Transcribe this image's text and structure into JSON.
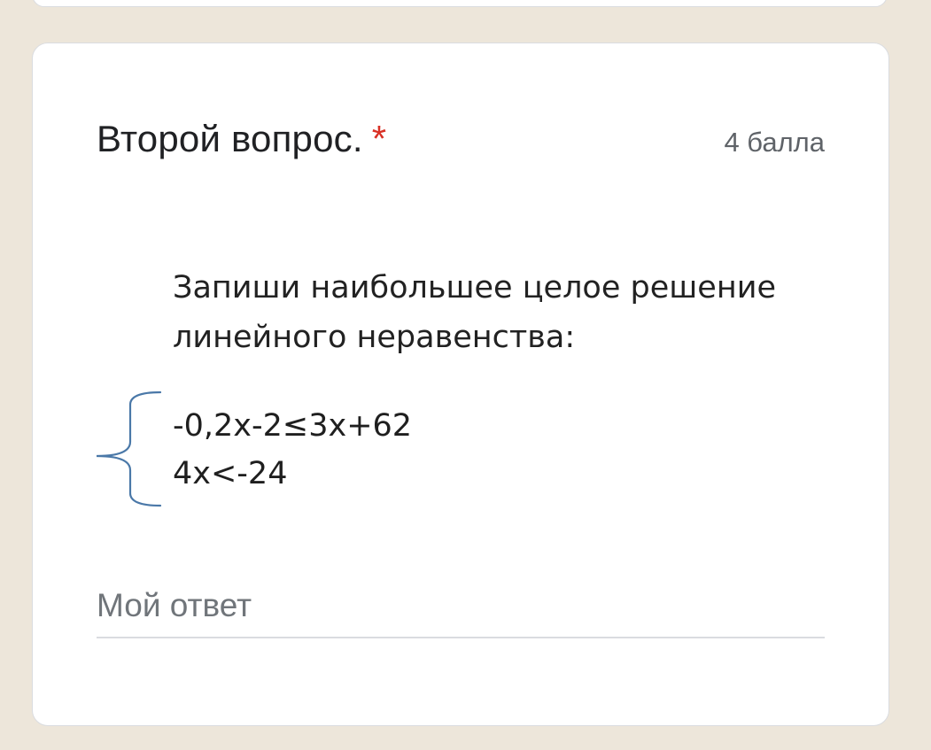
{
  "question": {
    "title": "Второй вопрос.",
    "required_mark": "*",
    "points": "4 балла"
  },
  "question_image": {
    "prompt_line_1": "Запиши наибольшее целое решение",
    "prompt_line_2": "линейного неравенства:",
    "inequality_1": "-0,2x-2≤3x+62",
    "inequality_2": "4x<-24",
    "brace_color": "#4a78a8"
  },
  "answer": {
    "placeholder": "Мой ответ",
    "value": ""
  },
  "colors": {
    "page_background": "#ede6da",
    "card_background": "#ffffff",
    "required_red": "#d93025",
    "secondary_text": "#5f6368"
  }
}
